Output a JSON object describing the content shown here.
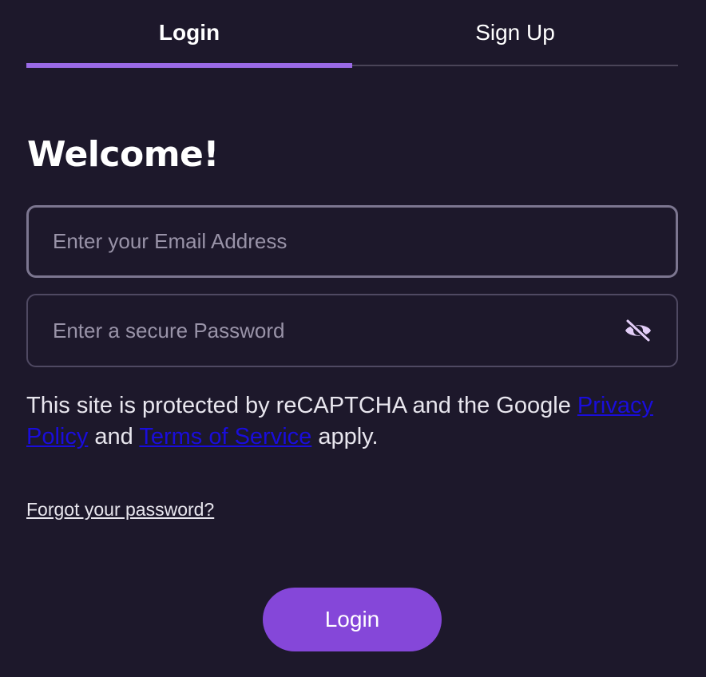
{
  "tabs": [
    {
      "label": "Login",
      "active": true
    },
    {
      "label": "Sign Up",
      "active": false
    }
  ],
  "heading": "Welcome!",
  "email_field": {
    "value": "",
    "placeholder": "Enter your Email Address"
  },
  "password_field": {
    "value": "",
    "placeholder": "Enter a secure Password",
    "toggle_icon": "eye-off-icon"
  },
  "recaptcha": {
    "prefix": "This site is protected by reCAPTCHA and the Google ",
    "privacy_link": "Privacy Policy",
    "middle": " and ",
    "terms_link": "Terms of Service",
    "suffix": " apply."
  },
  "forgot_link": "Forgot your password?",
  "submit_button": "Login",
  "colors": {
    "background": "#1d182b",
    "accent": "#9a6ae6",
    "button": "#8547d9",
    "link": "#1a0ddb"
  }
}
